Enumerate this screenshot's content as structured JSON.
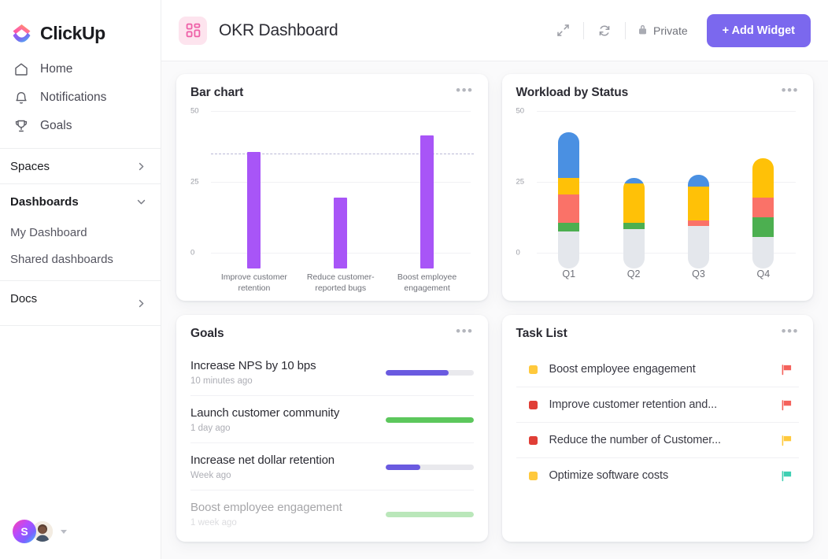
{
  "brand": {
    "name": "ClickUp",
    "purple": "#7b68ee"
  },
  "sidebar": {
    "nav": [
      {
        "label": "Home",
        "icon": "home-icon"
      },
      {
        "label": "Notifications",
        "icon": "bell-icon"
      },
      {
        "label": "Goals",
        "icon": "trophy-icon"
      }
    ],
    "sections": [
      {
        "label": "Spaces",
        "icon": "chevron-right-icon"
      },
      {
        "label": "Dashboards",
        "icon": "chevron-down-icon"
      },
      {
        "label": "Docs",
        "icon": "chevron-right-icon"
      }
    ],
    "dashboard_items": [
      {
        "label": "My Dashboard"
      },
      {
        "label": "Shared dashboards"
      }
    ],
    "user": {
      "initial": "S"
    }
  },
  "header": {
    "title": "OKR Dashboard",
    "icon": "dashboard-grid-icon",
    "expand_icon": "expand-arrows-icon",
    "refresh_icon": "refresh-icon",
    "privacy_label": "Private",
    "privacy_icon": "lock-icon",
    "add_widget_label": "+ Add Widget"
  },
  "widgets": {
    "bar_chart": {
      "title": "Bar chart",
      "menu": "•••"
    },
    "workload": {
      "title": "Workload by Status",
      "menu": "•••"
    },
    "goals": {
      "title": "Goals",
      "menu": "•••"
    },
    "tasks": {
      "title": "Task List",
      "menu": "•••"
    }
  },
  "chart_data": [
    {
      "type": "bar",
      "title": "Bar chart",
      "categories": [
        "Improve customer retention",
        "Reduce customer-reported bugs",
        "Boost employee engagement"
      ],
      "values": [
        41,
        25,
        47
      ],
      "ylim": [
        0,
        50
      ],
      "yticks": [
        0,
        25,
        50
      ],
      "ytick_labels": [
        "0",
        "25",
        "50"
      ],
      "bar_color": "#a855f7",
      "target_line": {
        "value": 35,
        "style": "dashed",
        "color": "#b9b8d6"
      },
      "grid": true,
      "legend": "none"
    },
    {
      "type": "bar",
      "subtype": "stacked",
      "title": "Workload by Status",
      "categories": [
        "Q1",
        "Q2",
        "Q3",
        "Q4"
      ],
      "ylim": [
        0,
        50
      ],
      "yticks": [
        0,
        25,
        50
      ],
      "ytick_labels": [
        "0",
        "25",
        "50"
      ],
      "series": [
        {
          "name": "to do",
          "color": "#e4e7ec",
          "values": [
            13,
            14,
            15,
            11
          ]
        },
        {
          "name": "in progress",
          "color": "#4caf50",
          "values": [
            3,
            2,
            0,
            7
          ]
        },
        {
          "name": "blocked",
          "color": "#fa7268",
          "values": [
            10,
            0,
            2,
            7
          ]
        },
        {
          "name": "review",
          "color": "#ffc107",
          "values": [
            6,
            14,
            12,
            14
          ]
        },
        {
          "name": "done",
          "color": "#4a90e2",
          "values": [
            16,
            2,
            4,
            0
          ]
        }
      ],
      "grid": true,
      "legend": "none"
    }
  ],
  "goals": [
    {
      "name": "Increase NPS by 10 bps",
      "time": "10 minutes ago",
      "progress": 72,
      "color": "#6a5ae0",
      "faded": false
    },
    {
      "name": "Launch customer community",
      "time": "1 day ago",
      "progress": 100,
      "color": "#5cc75c",
      "faded": false
    },
    {
      "name": "Increase net dollar retention",
      "time": "Week ago",
      "progress": 40,
      "color": "#6a5ae0",
      "faded": false
    },
    {
      "name": "Boost employee engagement",
      "time": "1 week ago",
      "progress": 100,
      "color": "#5cc75c",
      "faded": true
    }
  ],
  "tasks": [
    {
      "name": "Boost employee engagement",
      "status_color": "#ffc93c",
      "flag_color": "#f4615b"
    },
    {
      "name": "Improve customer retention and...",
      "status_color": "#e03e36",
      "flag_color": "#f4615b"
    },
    {
      "name": "Reduce the number of Customer...",
      "status_color": "#e03e36",
      "flag_color": "#ffc93c"
    },
    {
      "name": "Optimize software costs",
      "status_color": "#ffc93c",
      "flag_color": "#3ecfb2"
    }
  ]
}
